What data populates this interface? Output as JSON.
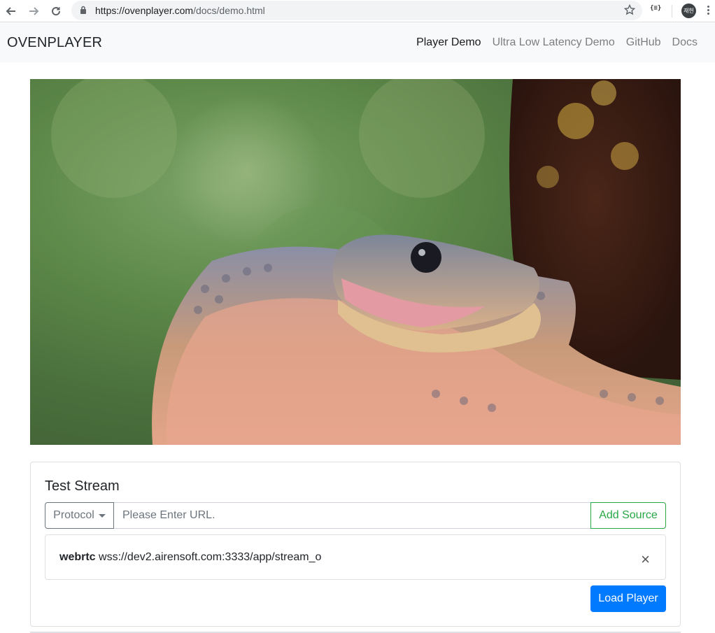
{
  "browser": {
    "url_domain": "https://ovenplayer.com",
    "url_path": "/docs/demo.html",
    "extension_label": "{≡}",
    "profile_initials": "재헌"
  },
  "navbar": {
    "brand": "OVENPLAYER",
    "links": [
      {
        "label": "Player Demo",
        "active": true
      },
      {
        "label": "Ultra Low Latency Demo",
        "active": false
      },
      {
        "label": "GitHub",
        "active": false
      },
      {
        "label": "Docs",
        "active": false
      }
    ]
  },
  "card": {
    "title": "Test Stream",
    "protocol_label": "Protocol",
    "url_placeholder": "Please Enter URL.",
    "add_source_label": "Add Source",
    "sources": [
      {
        "protocol": "webrtc",
        "url": "wss://dev2.airensoft.com:3333/app/stream_o"
      }
    ],
    "load_player_label": "Load Player"
  },
  "colors": {
    "primary": "#007bff",
    "success": "#28a745",
    "secondary": "#6c757d"
  }
}
